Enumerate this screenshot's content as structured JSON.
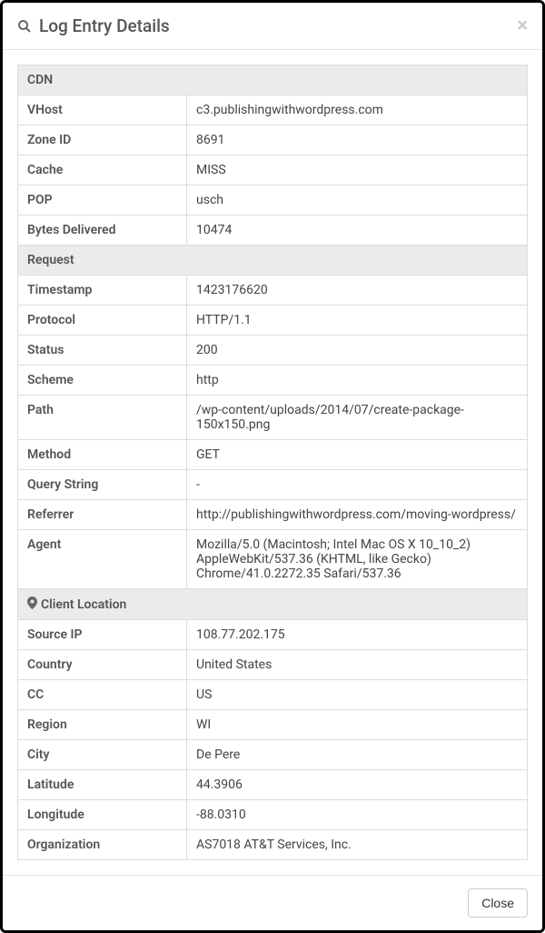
{
  "modal": {
    "title": "Log Entry Details",
    "close_button_label": "Close"
  },
  "sections": {
    "cdn": {
      "header": "CDN",
      "rows": [
        {
          "key": "VHost",
          "value": "c3.publishingwithwordpress.com"
        },
        {
          "key": "Zone ID",
          "value": "8691"
        },
        {
          "key": "Cache",
          "value": "MISS"
        },
        {
          "key": "POP",
          "value": "usch"
        },
        {
          "key": "Bytes Delivered",
          "value": "10474"
        }
      ]
    },
    "request": {
      "header": "Request",
      "rows": [
        {
          "key": "Timestamp",
          "value": "1423176620"
        },
        {
          "key": "Protocol",
          "value": "HTTP/1.1"
        },
        {
          "key": "Status",
          "value": "200"
        },
        {
          "key": "Scheme",
          "value": "http"
        },
        {
          "key": "Path",
          "value": "/wp-content/uploads/2014/07/create-package-150x150.png"
        },
        {
          "key": "Method",
          "value": "GET"
        },
        {
          "key": "Query String",
          "value": "-"
        },
        {
          "key": "Referrer",
          "value": "http://publishingwithwordpress.com/moving-wordpress/"
        },
        {
          "key": "Agent",
          "value": "Mozilla/5.0 (Macintosh; Intel Mac OS X 10_10_2) AppleWebKit/537.36 (KHTML, like Gecko) Chrome/41.0.2272.35 Safari/537.36"
        }
      ]
    },
    "client_location": {
      "header": "Client Location",
      "rows": [
        {
          "key": "Source IP",
          "value": "108.77.202.175"
        },
        {
          "key": "Country",
          "value": "United States"
        },
        {
          "key": "CC",
          "value": "US"
        },
        {
          "key": "Region",
          "value": "WI"
        },
        {
          "key": "City",
          "value": "De Pere"
        },
        {
          "key": "Latitude",
          "value": "44.3906"
        },
        {
          "key": "Longitude",
          "value": "-88.0310"
        },
        {
          "key": "Organization",
          "value": "AS7018 AT&T Services, Inc."
        }
      ]
    }
  }
}
